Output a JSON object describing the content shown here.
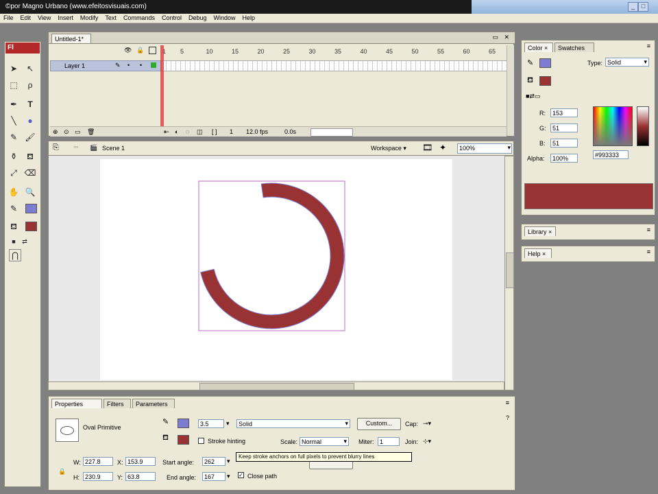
{
  "window": {
    "title": "©por Magno Urbano (www.efeitosvisuais.com)"
  },
  "menu": [
    "File",
    "Edit",
    "View",
    "Insert",
    "Modify",
    "Text",
    "Commands",
    "Control",
    "Debug",
    "Window",
    "Help"
  ],
  "toolbox": {
    "logo": "Fl"
  },
  "document": {
    "tab": "Untitled-1*"
  },
  "timeline": {
    "ruler": [
      "1",
      "5",
      "10",
      "15",
      "20",
      "25",
      "30",
      "35",
      "40",
      "45",
      "50",
      "55",
      "60",
      "65"
    ],
    "layer": "Layer 1",
    "frame": "1",
    "fps": "12.0 fps",
    "time": "0.0s"
  },
  "editbar": {
    "scene": "Scene 1",
    "workspace": "Workspace ▾",
    "zoom": "100%"
  },
  "colors": {
    "fill": "#993333",
    "stroke": "#7c7cd0",
    "accent": "#b3282b"
  },
  "properties": {
    "tabs": [
      "Properties",
      "Filters",
      "Parameters"
    ],
    "shape": "Oval Primitive",
    "stroke_height": "3.5",
    "stroke_style": "Solid",
    "custom": "Custom...",
    "cap": "Cap:",
    "stroke_hinting": "Stroke hinting",
    "scale_label": "Scale:",
    "scale": "Normal",
    "miter_label": "Miter:",
    "miter": "1",
    "join": "Join:",
    "w_label": "W:",
    "w": "227.8",
    "x_label": "X:",
    "x": "153.9",
    "h_label": "H:",
    "h": "230.9",
    "y_label": "Y:",
    "y": "63.8",
    "start_angle_label": "Start angle:",
    "start_angle": "262",
    "end_angle_label": "End angle:",
    "end_angle": "167",
    "close_path": "Close path",
    "tooltip": "Keep stroke anchors on full pixels to prevent blurry lines"
  },
  "color_panel": {
    "tabs": [
      "Color",
      "Swatches"
    ],
    "type_label": "Type:",
    "type": "Solid",
    "r_label": "R:",
    "r": "153",
    "g_label": "G:",
    "g": "51",
    "b_label": "B:",
    "b": "51",
    "alpha_label": "Alpha:",
    "alpha": "100%",
    "hex": "#993333"
  },
  "library": {
    "tab": "Library"
  },
  "help": {
    "tab": "Help"
  }
}
